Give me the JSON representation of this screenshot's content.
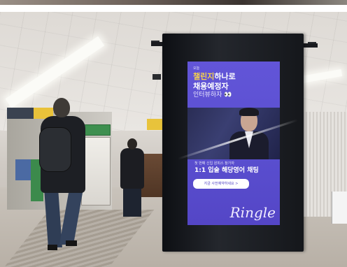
{
  "scene": {
    "description_tags": [
      "subway-station",
      "digital-signage",
      "commuters"
    ]
  },
  "ad_screen": {
    "kicker": "오늘",
    "headline_highlight": "챌린지",
    "headline_line1_rest": "하나로",
    "headline_line2": "채용예정자",
    "headline_line3": "인터뷰하자 👀",
    "caption": "첫 번째 신입 원피스 참가자",
    "subheadline": "1:1 입술 해당영어 채팅",
    "cta_label": "지금 사전예약하세요 >",
    "brand_mark": "Ringle"
  },
  "colors": {
    "screen_bg": "#5a4fd0",
    "highlight": "#f6d24a",
    "pillar": "#15171b"
  }
}
